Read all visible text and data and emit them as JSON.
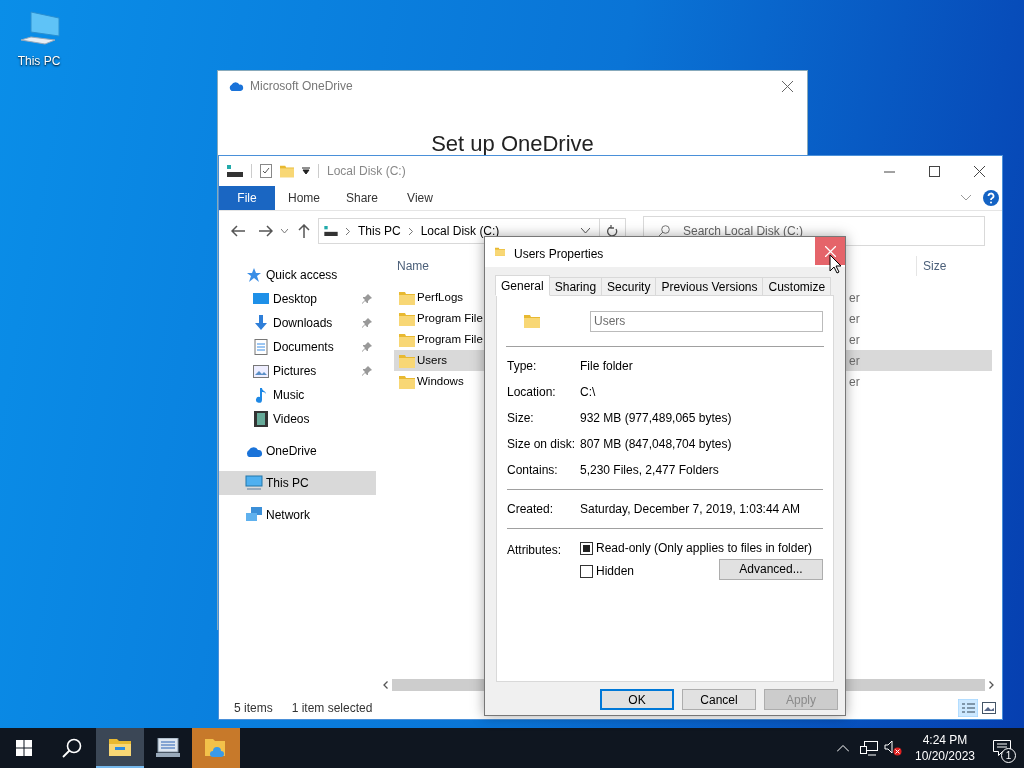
{
  "desktop_icons": [
    {
      "label": "This PC"
    }
  ],
  "onedrive_window": {
    "title": "Microsoft OneDrive",
    "heading": "Set up OneDrive"
  },
  "explorer": {
    "title": "Local Disk (C:)",
    "ribbon_tabs": [
      {
        "label": "File",
        "selected": true
      },
      {
        "label": "Home",
        "selected": false
      },
      {
        "label": "Share",
        "selected": false
      },
      {
        "label": "View",
        "selected": false
      }
    ],
    "breadcrumb": [
      "This PC",
      "Local Disk (C:)"
    ],
    "search": {
      "placeholder": "Search Local Disk (C:)"
    },
    "nav": [
      {
        "label": "Quick access",
        "selected": false,
        "children": [
          {
            "label": "Desktop",
            "pinned": true,
            "selected": false
          },
          {
            "label": "Downloads",
            "pinned": true,
            "selected": false
          },
          {
            "label": "Documents",
            "pinned": true,
            "selected": false
          },
          {
            "label": "Pictures",
            "pinned": true,
            "selected": false
          },
          {
            "label": "Music",
            "pinned": false,
            "selected": false
          },
          {
            "label": "Videos",
            "pinned": false,
            "selected": false
          }
        ]
      },
      {
        "label": "OneDrive",
        "selected": false
      },
      {
        "label": "This PC",
        "selected": true
      },
      {
        "label": "Network",
        "selected": false
      }
    ],
    "columns": [
      "Name",
      "Size"
    ],
    "rows": [
      {
        "name": "PerfLogs",
        "column_2": "er",
        "selected": false
      },
      {
        "name": "Program File",
        "column_2": "er",
        "selected": false
      },
      {
        "name": "Program File",
        "column_2": "er",
        "selected": false
      },
      {
        "name": "Users",
        "column_2": "er",
        "selected": true
      },
      {
        "name": "Windows",
        "column_2": "er",
        "selected": false
      }
    ],
    "status": [
      "5 items",
      "1 item selected"
    ]
  },
  "dialog": {
    "title": "Users Properties",
    "tabs": [
      {
        "label": "General",
        "selected": true
      },
      {
        "label": "Sharing",
        "selected": false
      },
      {
        "label": "Security",
        "selected": false
      },
      {
        "label": "Previous Versions",
        "selected": false
      },
      {
        "label": "Customize",
        "selected": false
      }
    ],
    "name_value": "Users",
    "properties": [
      {
        "label": "Type:",
        "value": "File folder"
      },
      {
        "label": "Location:",
        "value": "C:\\"
      },
      {
        "label": "Size:",
        "value": "932 MB (977,489,065 bytes)"
      },
      {
        "label": "Size on disk:",
        "value": "807 MB (847,048,704 bytes)"
      },
      {
        "label": "Contains:",
        "value": "5,230 Files, 2,477 Folders"
      }
    ],
    "created": {
      "label": "Created:",
      "value": "Saturday, December 7, 2019, 1:03:44 AM"
    },
    "attributes_label": "Attributes:",
    "attributes": [
      {
        "label": "Read-only (Only applies to files in folder)",
        "checked": true
      },
      {
        "label": "Hidden",
        "checked": false
      }
    ],
    "advanced_button": "Advanced...",
    "buttons": [
      {
        "label": "OK",
        "default": true,
        "disabled": false
      },
      {
        "label": "Cancel",
        "default": false,
        "disabled": false
      },
      {
        "label": "Apply",
        "default": false,
        "disabled": true
      }
    ]
  },
  "taskbar": {
    "apps": [
      {
        "active": true
      },
      {
        "active": false
      },
      {
        "active": false
      }
    ],
    "time": "4:24 PM",
    "date": "10/20/2023",
    "notifications": "1"
  }
}
